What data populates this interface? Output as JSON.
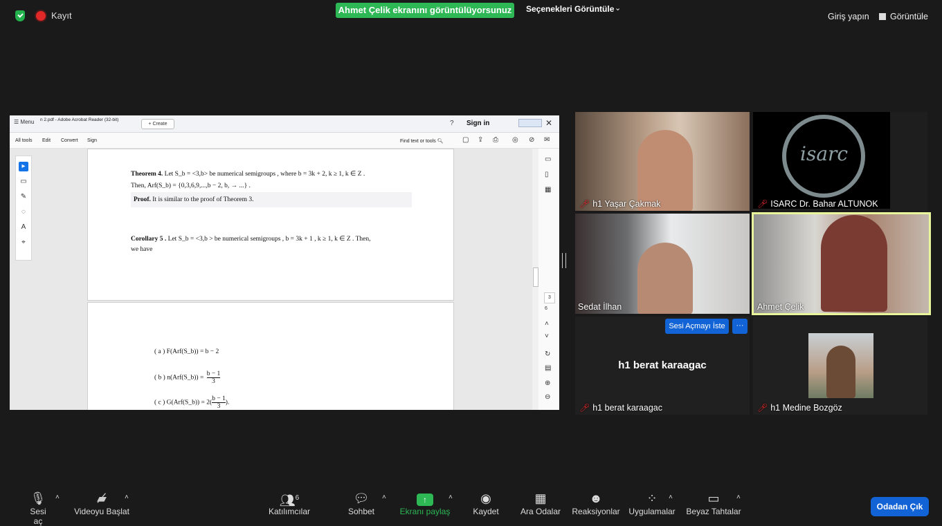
{
  "top": {
    "recording_label": "Kayıt",
    "share_banner": "Ahmet Çelik ekranını görüntülüyorsunuz",
    "view_options": "Seçenekleri Görüntüle",
    "sign_in": "Giriş yapın",
    "view": "Görüntüle"
  },
  "acrobat": {
    "menu": "Menu",
    "tab_title": "n 2.pdf - Adobe Acrobat Reader (32-bit)",
    "create": "+ Create",
    "signin": "Sign in",
    "tools": [
      "All tools",
      "Edit",
      "Convert",
      "Sign"
    ],
    "find": "Find text or tools",
    "page_numbers": [
      "3",
      "6"
    ],
    "doc": {
      "theorem4_a": "Theorem 4.",
      "theorem4_b": "Let S_b = <3,b> be numerical semigroups , where b = 3k + 2, k ≥ 1, k ∈ Z .",
      "theorem4_c": "Then, Arf(S_b) = {0,3,6,9,...,b − 2, b, → ...} .",
      "proof_a": "Proof.",
      "proof_b": "It is similar to the proof of Theorem 3.",
      "corollary_a": "Corollary 5 .",
      "corollary_b": "Let S_b = <3,b > be numerical semigroups , b = 3k + 1 , k ≥ 1, k ∈ Z . Then,",
      "corollary_c": "we have",
      "item_a": "( a ) F(Arf(S_b)) = b − 2",
      "item_b_lhs": "( b ) n(Arf(S_b)) =",
      "item_b_num": "b − 1",
      "item_b_den": "3",
      "item_c_lhs": "( c ) G(Arf(S_b)) = 2(",
      "item_c_num": "b − 1",
      "item_c_den": "3",
      "item_c_rhs": ")."
    }
  },
  "participants": [
    {
      "name": "h1 Yaşar Çakmak",
      "muted": true
    },
    {
      "name": "ISARC Dr. Bahar ALTUNOK",
      "muted": true
    },
    {
      "name": "Sedat İlhan",
      "muted": false
    },
    {
      "name": "Ahmet Çelik",
      "muted": false
    },
    {
      "name": "h1 berat karaagac",
      "muted": true,
      "big_name": "h1 berat karaagac",
      "request_unmute": "Sesi Açmayı İste",
      "more": "···"
    },
    {
      "name": "h1 Medine Bozgöz",
      "muted": true
    }
  ],
  "bottom": {
    "unmute": "Sesi aç",
    "start_video": "Videoyu Başlat",
    "participants": "Katılımcılar",
    "participants_count": "6",
    "chat": "Sohbet",
    "share": "Ekranı paylaş",
    "record": "Kaydet",
    "breakout": "Ara Odalar",
    "reactions": "Reaksiyonlar",
    "apps": "Uygulamalar",
    "whiteboard": "Beyaz Tahtalar",
    "leave": "Odadan Çık"
  },
  "colors": {
    "banner": "#2db755",
    "leave": "#1163d6",
    "mute_red": "#e02828",
    "active_speaker": "#e9f59a"
  }
}
